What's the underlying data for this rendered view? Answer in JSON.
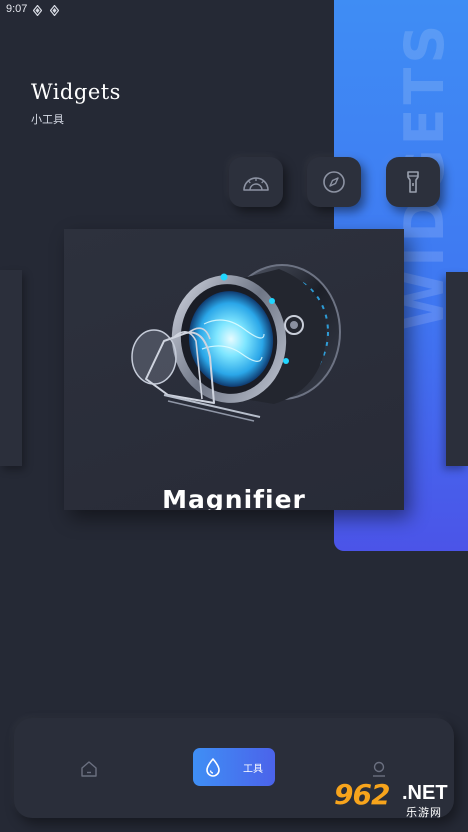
{
  "status_bar": {
    "time": "9:07"
  },
  "banner": {
    "vertical_text": "WIDGETS",
    "color": "#3f7ff2"
  },
  "header": {
    "title": "Widgets",
    "subtitle": "小工具"
  },
  "tools": [
    {
      "icon": "protractor-icon"
    },
    {
      "icon": "compass-icon"
    },
    {
      "icon": "flashlight-icon"
    }
  ],
  "carousel": {
    "active_card": {
      "title": "Magnifier",
      "icon": "magnifier-illustration"
    }
  },
  "bottom_nav": {
    "items": [
      {
        "icon": "home-icon",
        "active": false
      },
      {
        "icon": "water-drop-icon",
        "label": "工具",
        "active": true
      },
      {
        "icon": "profile-icon",
        "active": false
      }
    ],
    "accent": "#4178f0"
  },
  "watermark": {
    "number": "962",
    "domain": ".NET",
    "text": "乐游网"
  }
}
